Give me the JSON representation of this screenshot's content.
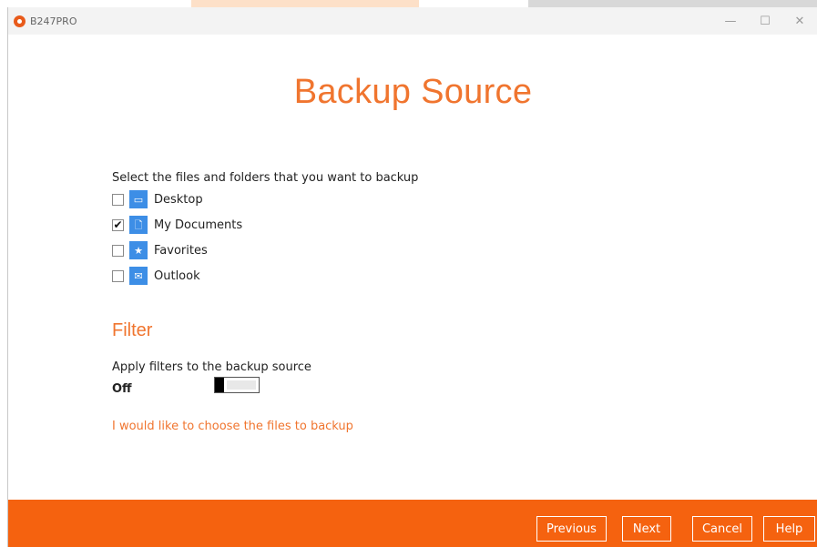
{
  "window": {
    "app_title": "B247PRO",
    "controls": {
      "minimize": "—",
      "maximize": "☐",
      "close": "✕"
    }
  },
  "page": {
    "title": "Backup Source"
  },
  "source": {
    "prompt": "Select the files and folders that you want to backup",
    "items": [
      {
        "label": "Desktop",
        "checked": false,
        "icon": "desktop-icon",
        "glyph": "▭"
      },
      {
        "label": "My Documents",
        "checked": true,
        "icon": "document-icon",
        "glyph": "🗋"
      },
      {
        "label": "Favorites",
        "checked": false,
        "icon": "star-icon",
        "glyph": "★"
      },
      {
        "label": "Outlook",
        "checked": false,
        "icon": "mail-icon",
        "glyph": "✉"
      }
    ]
  },
  "filter": {
    "heading": "Filter",
    "description": "Apply filters to the backup source",
    "state": "Off",
    "enabled": false
  },
  "link": {
    "choose_files": "I would like to choose the files to backup"
  },
  "footer": {
    "previous": "Previous",
    "next": "Next",
    "cancel": "Cancel",
    "help": "Help"
  },
  "colors": {
    "accent": "#f0752f",
    "footer_bg": "#f5620f",
    "icon_blue": "#3d8ee6"
  }
}
